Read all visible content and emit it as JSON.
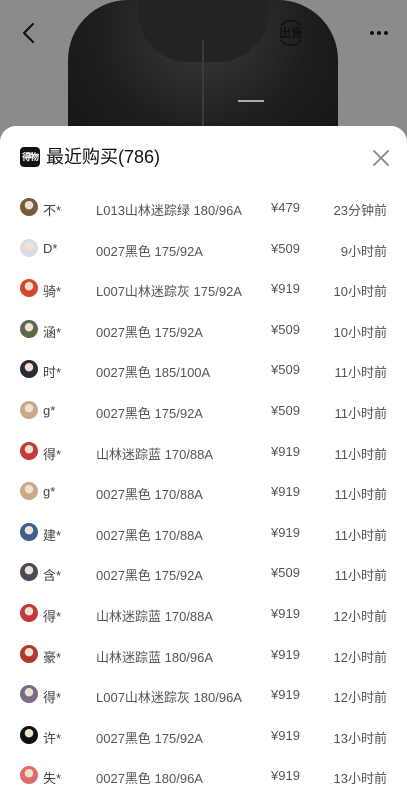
{
  "nav": {
    "back_icon": "chevron-left-icon",
    "sell_label": "出售",
    "more_icon": "ellipsis-icon"
  },
  "sheet": {
    "logo_text": "得物",
    "title": "最近购买(786)",
    "close_icon": "close-icon"
  },
  "purchases": [
    {
      "user": "不*",
      "spec": "L013山林迷踪绿 180/96A",
      "price": "¥479",
      "time": "23分钟前",
      "avatar_color": "#7a5a3a"
    },
    {
      "user": "D*",
      "spec": "0027黑色 175/92A",
      "price": "¥509",
      "time": "9小时前",
      "avatar_color": "#d8dde4"
    },
    {
      "user": "骑*",
      "spec": "L007山林迷踪灰 175/92A",
      "price": "¥919",
      "time": "10小时前",
      "avatar_color": "#d1492a"
    },
    {
      "user": "涵*",
      "spec": "0027黑色 175/92A",
      "price": "¥509",
      "time": "10小时前",
      "avatar_color": "#5c6a4e"
    },
    {
      "user": "时*",
      "spec": "0027黑色 185/100A",
      "price": "¥509",
      "time": "11小时前",
      "avatar_color": "#2a2a3a"
    },
    {
      "user": "g*",
      "spec": "0027黑色 175/92A",
      "price": "¥509",
      "time": "11小时前",
      "avatar_color": "#c9a98a"
    },
    {
      "user": "得*",
      "spec": "山林迷踪蓝 170/88A",
      "price": "¥919",
      "time": "11小时前",
      "avatar_color": "#c23a3a"
    },
    {
      "user": "g*",
      "spec": "0027黑色 170/88A",
      "price": "¥919",
      "time": "11小时前",
      "avatar_color": "#c9a98a"
    },
    {
      "user": "建*",
      "spec": "0027黑色 170/88A",
      "price": "¥919",
      "time": "11小时前",
      "avatar_color": "#3e5e8c"
    },
    {
      "user": "含*",
      "spec": "0027黑色 175/92A",
      "price": "¥509",
      "time": "11小时前",
      "avatar_color": "#4a4a5a"
    },
    {
      "user": "得*",
      "spec": "山林迷踪蓝 170/88A",
      "price": "¥919",
      "time": "12小时前",
      "avatar_color": "#c23a3a"
    },
    {
      "user": "豪*",
      "spec": "山林迷踪蓝 180/96A",
      "price": "¥919",
      "time": "12小时前",
      "avatar_color": "#b13a2a"
    },
    {
      "user": "得*",
      "spec": "L007山林迷踪灰 180/96A",
      "price": "¥919",
      "time": "12小时前",
      "avatar_color": "#7a6a8a"
    },
    {
      "user": "许*",
      "spec": "0027黑色 175/92A",
      "price": "¥919",
      "time": "13小时前",
      "avatar_color": "#111111"
    },
    {
      "user": "失*",
      "spec": "0027黑色 180/96A",
      "price": "¥919",
      "time": "13小时前",
      "avatar_color": "#e26a6a"
    }
  ]
}
